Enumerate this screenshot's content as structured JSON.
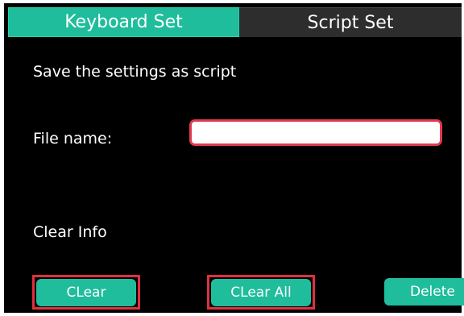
{
  "tabs": {
    "keyboard_set": "Keyboard Set",
    "script_set": "Script Set"
  },
  "save_section": {
    "title": "Save the settings as script",
    "file_name_label": "File name:",
    "file_name_value": ""
  },
  "clear_section": {
    "title": "Clear Info",
    "clear_label": "CLear",
    "clear_all_label": "CLear All",
    "delete_label": "Delete"
  },
  "colors": {
    "accent": "#1fbd9c",
    "highlight": "#e0303e",
    "background": "#000000"
  }
}
